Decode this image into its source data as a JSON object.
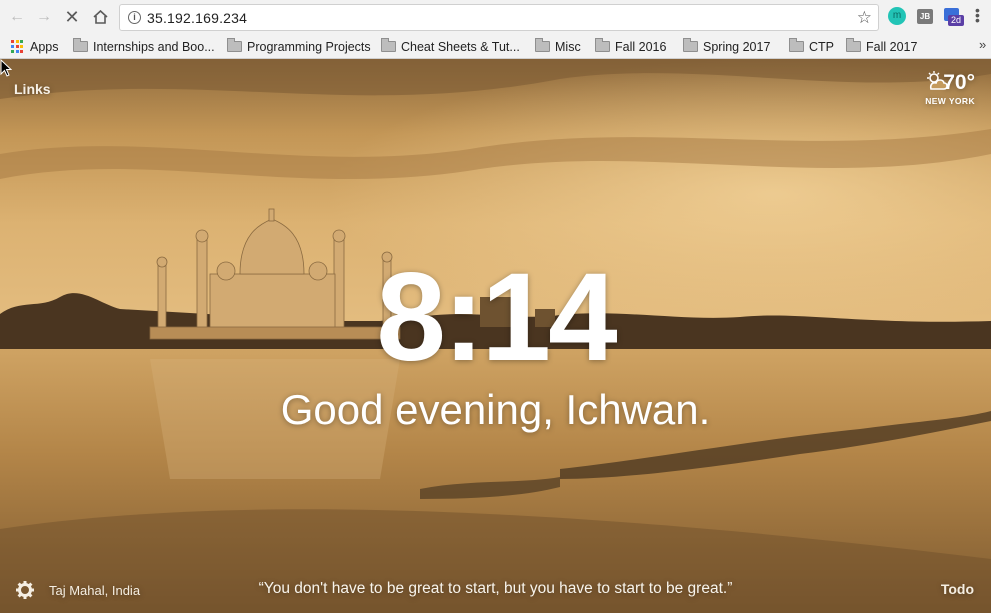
{
  "browser": {
    "url": "35.192.169.234",
    "extensions": [
      {
        "icon": "monitor-extension-icon",
        "text": "m"
      },
      {
        "icon": "jetbrains-extension-icon",
        "text": "JB"
      },
      {
        "icon": "calendar-extension-icon",
        "text": "2d"
      }
    ],
    "bookmarks": [
      {
        "label": "Apps",
        "icon": "apps-grid-icon"
      },
      {
        "label": "Internships and Boo...",
        "icon": "folder-icon"
      },
      {
        "label": "Programming Projects",
        "icon": "folder-icon"
      },
      {
        "label": "Cheat Sheets & Tut...",
        "icon": "folder-icon"
      },
      {
        "label": "Misc",
        "icon": "folder-icon"
      },
      {
        "label": "Fall 2016",
        "icon": "folder-icon"
      },
      {
        "label": "Spring 2017",
        "icon": "folder-icon"
      },
      {
        "label": "CTP",
        "icon": "folder-icon"
      },
      {
        "label": "Fall 2017",
        "icon": "folder-icon"
      }
    ],
    "more_bookmarks": "»"
  },
  "dashboard": {
    "links_label": "Links",
    "weather": {
      "temperature": "70°",
      "location": "NEW YORK",
      "icon": "partly-cloudy-icon"
    },
    "time": "8:14",
    "greeting": "Good evening, Ichwan.",
    "photo_location": "Taj Mahal, India",
    "quote": "“You don't have to be great to start, but you have to start to be great.”",
    "todo_label": "Todo"
  },
  "colors": {
    "sky": "#c99c5a",
    "river": "#b3874a",
    "chrome": "#f2f2f2"
  }
}
